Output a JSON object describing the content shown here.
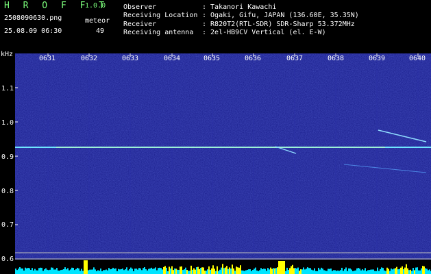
{
  "header": {
    "app_title": "H R O F F T",
    "version": "1.0.0",
    "filename": "2508090630.png",
    "datetime": "25.08.09 06:30",
    "meteor_label": "meteor",
    "meteor_count": "49"
  },
  "info": [
    {
      "key": "Observer",
      "value": ": Takanori Kawachi"
    },
    {
      "key": "Receiving Location",
      "value": ": Ogaki, Gifu, JAPAN (136.60E, 35.35N)"
    },
    {
      "key": "Receiver",
      "value": ": R820T2(RTL-SDR) SDR-Sharp 53.372MHz"
    },
    {
      "key": "Receiving antenna",
      "value": ": 2el-HB9CV Vertical (el. E-W)"
    }
  ],
  "axis": {
    "y_unit": "kHz",
    "y_ticks": [
      "1.1",
      "1.0",
      "0.9",
      "0.8",
      "0.7",
      "0.6"
    ],
    "x_ticks": [
      "0631",
      "0632",
      "0633",
      "0634",
      "0635",
      "0636",
      "0637",
      "0638",
      "0639",
      "0640"
    ]
  },
  "colors": {
    "title_green": "#7cff7c",
    "background": "#000000",
    "spectrogram_base": "#1a1e8c",
    "carrier_line": "#6fe6ff",
    "level_bar": "#00e5ff",
    "level_peak": "#ffff00"
  }
}
